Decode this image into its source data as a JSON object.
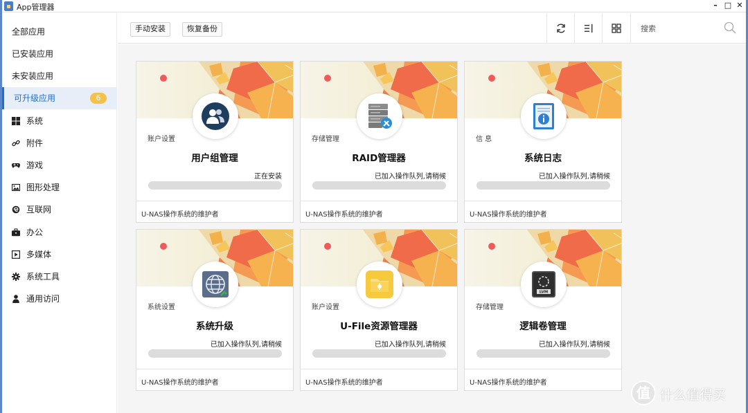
{
  "window": {
    "title": "App管理器",
    "controls": [
      "minimize-icon",
      "maximize-icon",
      "close-icon"
    ]
  },
  "sidebar": {
    "items": [
      {
        "label": "全部应用",
        "active": false
      },
      {
        "label": "已安装应用",
        "active": false
      },
      {
        "label": "未安装应用",
        "active": false
      },
      {
        "label": "可升级应用",
        "active": true,
        "badge": "6"
      }
    ],
    "categories": [
      {
        "label": "系统",
        "icon": "windows-icon"
      },
      {
        "label": "附件",
        "icon": "link-icon"
      },
      {
        "label": "游戏",
        "icon": "gamepad-icon"
      },
      {
        "label": "图形处理",
        "icon": "image-icon"
      },
      {
        "label": "互联网",
        "icon": "internet-icon"
      },
      {
        "label": "办公",
        "icon": "briefcase-icon"
      },
      {
        "label": "多媒体",
        "icon": "play-icon"
      },
      {
        "label": "系统工具",
        "icon": "gear-icon"
      },
      {
        "label": "通用访问",
        "icon": "user-icon"
      }
    ]
  },
  "toolbar": {
    "manual_install": "手动安装",
    "restore_backup": "恢复备份",
    "icons": [
      "refresh-icon",
      "list-view-icon",
      "grid-view-icon"
    ],
    "search_placeholder": "搜索"
  },
  "cards": [
    {
      "category": "账户设置",
      "name": "用户组管理",
      "status": "正在安装",
      "progress": 0,
      "maintainer": "U-NAS操作系统的维护者",
      "icon": "user-group-icon"
    },
    {
      "category": "存储管理",
      "name": "RAID管理器",
      "status": "已加入操作队列,请稍候",
      "progress": 0,
      "maintainer": "U-NAS操作系统的维护者",
      "icon": "raid-icon"
    },
    {
      "category": "信 息",
      "name": "系统日志",
      "status": "已加入操作队列,请稍候",
      "progress": 0,
      "maintainer": "U-NAS操作系统的维护者",
      "icon": "log-icon"
    },
    {
      "category": "系统设置",
      "name": "系统升级",
      "status": "已加入操作队列,请稍候",
      "progress": 0,
      "maintainer": "U-NAS操作系统的维护者",
      "icon": "globe-icon"
    },
    {
      "category": "账户设置",
      "name": "U-File资源管理器",
      "status": "已加入操作队列,请稍候",
      "progress": 0,
      "maintainer": "U-NAS操作系统的维护者",
      "icon": "folder-icon"
    },
    {
      "category": "存储管理",
      "name": "逻辑卷管理",
      "status": "已加入操作队列,请稍候",
      "progress": 0,
      "maintainer": "U-NAS操作系统的维护者",
      "icon": "lvm-icon",
      "icon_text": "LVM"
    }
  ],
  "watermark": {
    "logo": "值",
    "text": "什么值得买"
  },
  "colors": {
    "accent": "#1f6fd0",
    "badge": "#f6c14b",
    "red_dot": "#ef5a5a",
    "frame": "#5b86c9"
  }
}
